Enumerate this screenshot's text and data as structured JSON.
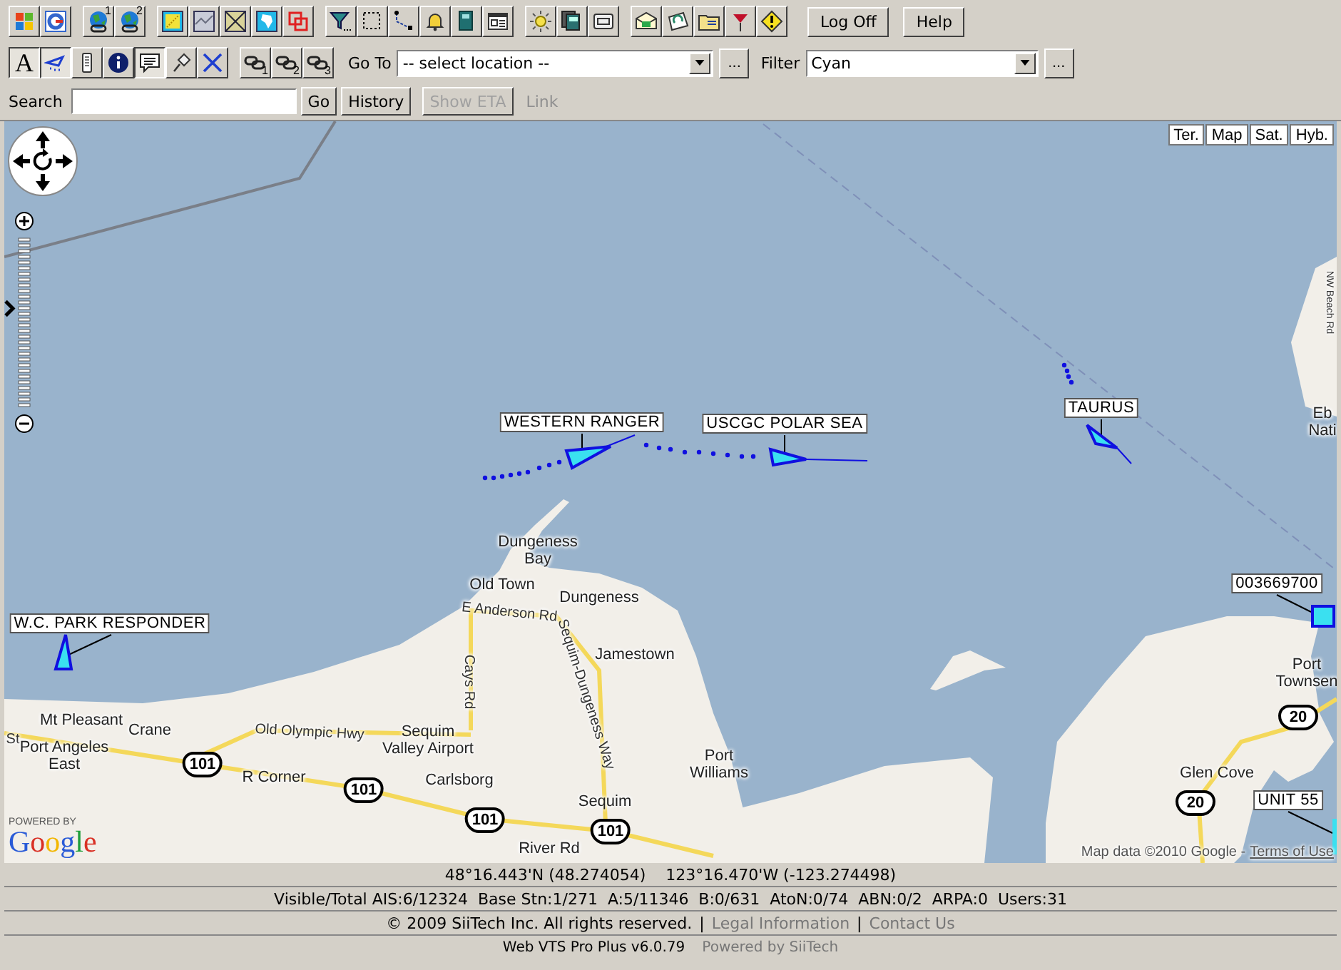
{
  "toolbar": {
    "tool_groups": [
      [
        {
          "kind": "windows"
        },
        {
          "kind": "google"
        }
      ],
      [
        {
          "kind": "globe",
          "index": "1"
        },
        {
          "kind": "globe",
          "index": "2"
        }
      ],
      [
        {
          "kind": "layer-dots"
        },
        {
          "kind": "layer-photo"
        },
        {
          "kind": "layer-cross"
        },
        {
          "kind": "layer-continent"
        },
        {
          "kind": "layer-squares"
        }
      ],
      [
        {
          "kind": "filter"
        },
        {
          "kind": "select"
        },
        {
          "kind": "route"
        },
        {
          "kind": "bell"
        },
        {
          "kind": "book"
        },
        {
          "kind": "window"
        }
      ],
      [
        {
          "kind": "sun"
        },
        {
          "kind": "pages"
        },
        {
          "kind": "screen"
        }
      ],
      [
        {
          "kind": "envelope"
        },
        {
          "kind": "envelope-open"
        },
        {
          "kind": "folder"
        },
        {
          "kind": "flag"
        },
        {
          "kind": "warning"
        }
      ]
    ],
    "buttons": [
      {
        "label": "Log Off"
      },
      {
        "label": "Help"
      }
    ]
  },
  "toolbar2": {
    "tool_groups": [
      [
        {
          "kind": "text",
          "label": "A",
          "pressed": true
        },
        {
          "kind": "vessel",
          "pressed": true
        },
        {
          "kind": "device",
          "pressed": false
        },
        {
          "kind": "info",
          "pressed": false
        },
        {
          "kind": "comment",
          "pressed": true
        },
        {
          "kind": "pin",
          "pressed": false
        },
        {
          "kind": "cross",
          "pressed": false
        }
      ],
      [
        {
          "kind": "link",
          "index": "1",
          "pressed": false
        },
        {
          "kind": "link",
          "index": "2",
          "pressed": false
        },
        {
          "kind": "link",
          "index": "3",
          "pressed": false
        }
      ]
    ],
    "goto": {
      "label": "Go To",
      "value": "-- select location --",
      "more": "..."
    },
    "filter": {
      "label": "Filter",
      "value": "Cyan",
      "more": "..."
    }
  },
  "searchbar": {
    "label": "Search",
    "go": "Go",
    "history": "History",
    "show_eta": {
      "label": "Show ETA",
      "disabled": true
    },
    "link": {
      "label": "Link",
      "disabled": true
    }
  },
  "map": {
    "map_types": [
      {
        "label": "Ter."
      },
      {
        "label": "Map"
      },
      {
        "label": "Sat."
      },
      {
        "label": "Hyb."
      }
    ],
    "places": [
      {
        "text": "Dungeness\nBay",
        "kind": "town"
      },
      {
        "text": "Old Town",
        "kind": "town"
      },
      {
        "text": "Dungeness",
        "kind": "town"
      },
      {
        "text": "E Anderson Rd",
        "kind": "road"
      },
      {
        "text": "Cays Rd",
        "kind": "road"
      },
      {
        "text": "Sequim-Dungeness Way",
        "kind": "road"
      },
      {
        "text": "Jamestown",
        "kind": "town"
      },
      {
        "text": "Mt Pleasant",
        "kind": "town"
      },
      {
        "text": "St",
        "kind": "road"
      },
      {
        "text": "Crane",
        "kind": "town"
      },
      {
        "text": "Port Angeles\nEast",
        "kind": "town"
      },
      {
        "text": "Old Olympic Hwy",
        "kind": "road"
      },
      {
        "text": "Sequim\nValley Airport",
        "kind": "town"
      },
      {
        "text": "R Corner",
        "kind": "town"
      },
      {
        "text": "Carlsborg",
        "kind": "town"
      },
      {
        "text": "Sequim",
        "kind": "town"
      },
      {
        "text": "River Rd",
        "kind": "town"
      },
      {
        "text": "Port\nWilliams",
        "kind": "town"
      },
      {
        "text": "Port\nTownsen",
        "kind": "town"
      },
      {
        "text": "Glen Cove",
        "kind": "town"
      },
      {
        "text": "NW Beach Rd",
        "kind": "road"
      },
      {
        "text": "Eb\nNati",
        "kind": "town"
      }
    ],
    "shields": [
      {
        "text": "101"
      },
      {
        "text": "101"
      },
      {
        "text": "101"
      },
      {
        "text": "101"
      },
      {
        "text": "20"
      },
      {
        "text": "20"
      }
    ],
    "vessels": [
      {
        "name": "WESTERN RANGER",
        "kind": "triangle"
      },
      {
        "name": "USCGC POLAR SEA",
        "kind": "triangle"
      },
      {
        "name": "TAURUS",
        "kind": "triangle"
      },
      {
        "name": "W.C. PARK RESPONDER",
        "kind": "triangle"
      },
      {
        "name": "003669700",
        "kind": "square"
      },
      {
        "name": "UNIT 55",
        "kind": "edge"
      }
    ],
    "zoom": {
      "level": 0.6
    },
    "powered_by": "POWERED BY",
    "google_logo": "Google",
    "attribution": "Map data ©2010 Google -",
    "terms": "Terms of Use"
  },
  "status": {
    "position": "48°16.443'N (48.274054)    123°16.470'W (-123.274498)",
    "counts": "Visible/Total AIS:6/12324  Base Stn:1/271  A:5/11346  B:0/631  AtoN:0/74  ABN:0/2  ARPA:0  Users:31",
    "copyright": "© 2009 SiiTech Inc. All rights reserved.",
    "separator": "|",
    "links": [
      "Legal Information",
      "Contact Us"
    ],
    "version": "Web VTS Pro Plus v6.0.79",
    "powered": "Powered by SiiTech"
  }
}
